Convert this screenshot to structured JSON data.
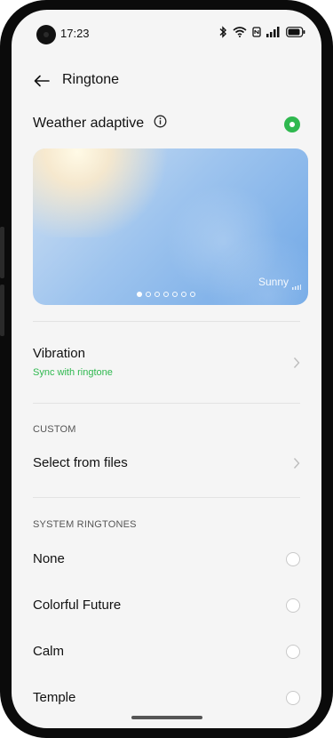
{
  "status_bar": {
    "time": "17:23",
    "icons": [
      "bluetooth-icon",
      "wifi-icon",
      "nfc-icon",
      "cell-signal-icon",
      "battery-icon"
    ]
  },
  "header": {
    "title": "Ringtone",
    "back_icon": "back-arrow-icon"
  },
  "weather_adaptive": {
    "label": "Weather adaptive",
    "info_icon": "info-icon",
    "enabled": true,
    "accent": "#2fb84f"
  },
  "weather_card": {
    "condition_label": "Sunny",
    "page_count": 7,
    "active_page": 1,
    "sky_colors": [
      "#cfe0f3",
      "#6fa7e6"
    ]
  },
  "vibration": {
    "title": "Vibration",
    "subtitle": "Sync with ringtone"
  },
  "custom": {
    "heading": "CUSTOM",
    "select_files": "Select from files"
  },
  "system_ringtones": {
    "heading": "SYSTEM RINGTONES",
    "items": [
      {
        "label": "None",
        "selected": false
      },
      {
        "label": "Colorful Future",
        "selected": false
      },
      {
        "label": "Calm",
        "selected": false
      },
      {
        "label": "Temple",
        "selected": false
      }
    ]
  }
}
